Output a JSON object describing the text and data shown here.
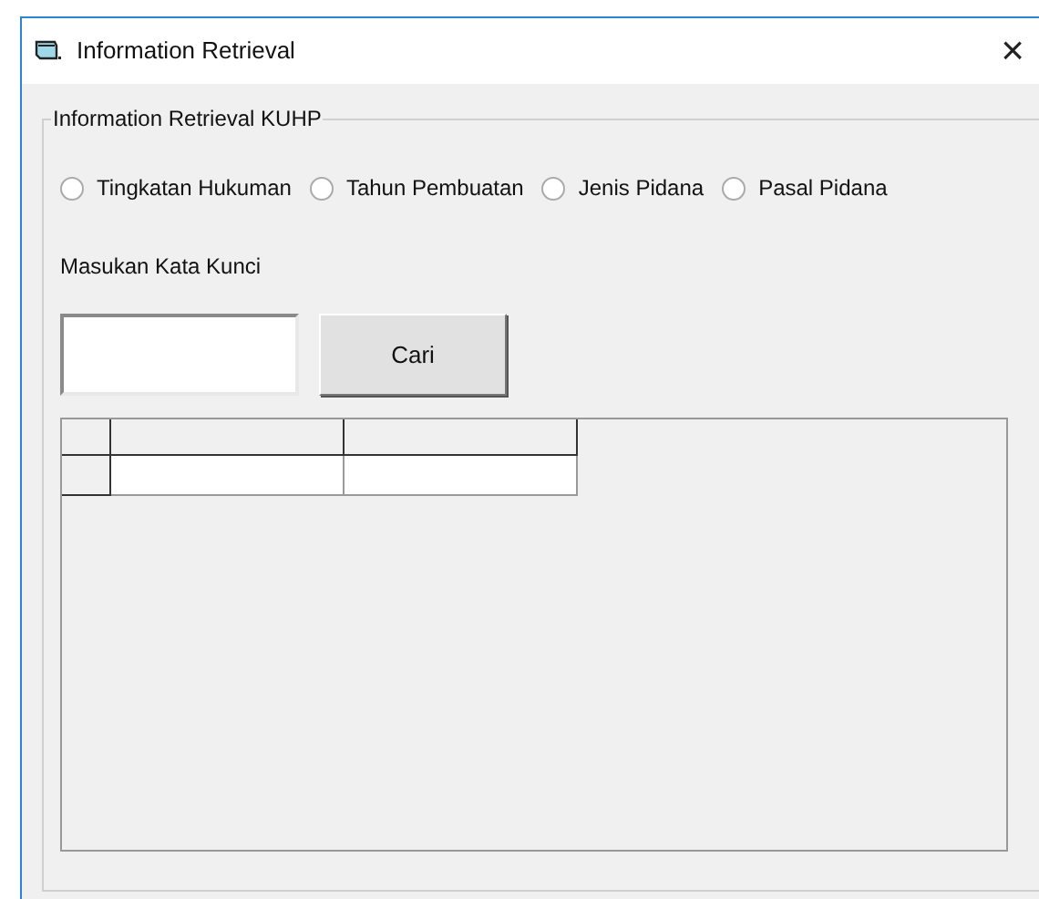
{
  "window": {
    "title": "Information Retrieval",
    "close": "×"
  },
  "group": {
    "legend": "Information Retrieval KUHP"
  },
  "radios": [
    {
      "label": "Tingkatan Hukuman",
      "selected": false
    },
    {
      "label": "Tahun Pembuatan",
      "selected": false
    },
    {
      "label": "Jenis Pidana",
      "selected": false
    },
    {
      "label": "Pasal Pidana",
      "selected": false
    }
  ],
  "keyword": {
    "label": "Masukan Kata Kunci"
  },
  "search_button": "Cari"
}
